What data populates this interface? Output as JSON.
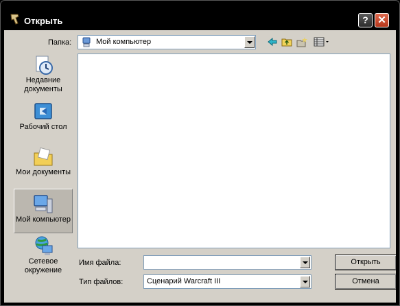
{
  "window": {
    "title": "Открыть",
    "help_label": "?",
    "close_label": "✕"
  },
  "folder": {
    "label": "Папка:",
    "value": "Мой компьютер"
  },
  "toolbar": {
    "icons": [
      "back-arrow-icon",
      "up-folder-icon",
      "new-folder-icon",
      "view-menu-icon"
    ]
  },
  "places": [
    {
      "label_line1": "Недавние",
      "label_line2": "документы",
      "icon": "recent-documents-icon"
    },
    {
      "label_line1": "Рабочий стол",
      "label_line2": "",
      "icon": "desktop-icon"
    },
    {
      "label_line1": "Мои документы",
      "label_line2": "",
      "icon": "my-documents-icon"
    },
    {
      "label_line1": "Мой компьютер",
      "label_line2": "",
      "icon": "my-computer-icon",
      "selected": true
    },
    {
      "label_line1": "Сетевое",
      "label_line2": "окружение",
      "icon": "network-icon"
    }
  ],
  "filename": {
    "label": "Имя файла:",
    "value": ""
  },
  "filetype": {
    "label": "Тип файлов:",
    "value": "Сценарий Warcraft III"
  },
  "buttons": {
    "open": "Открыть",
    "cancel": "Отмена"
  }
}
